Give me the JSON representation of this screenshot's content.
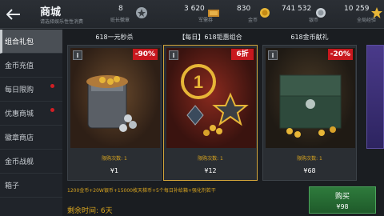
{
  "header": {
    "title": "商城",
    "subtitle": "请选择娱乐性性消费",
    "stats": [
      {
        "value": "8",
        "label": "贬长徽章"
      },
      {
        "value": "3 620",
        "label": "军需券"
      },
      {
        "value": "830",
        "label": "金币"
      },
      {
        "value": "741 532",
        "label": "银币"
      },
      {
        "value": "10 259",
        "label": "全局经验"
      }
    ]
  },
  "sidebar": {
    "items": [
      {
        "label": "组合礼包"
      },
      {
        "label": "金币充值"
      },
      {
        "label": "每日限购"
      },
      {
        "label": "优惠商城"
      },
      {
        "label": "徽章商店"
      },
      {
        "label": "金币战舰"
      },
      {
        "label": "箱子"
      }
    ]
  },
  "cards": [
    {
      "title": "618一元秒杀",
      "badge": "-90%",
      "limit": "限购次数: 1",
      "price": "¥1"
    },
    {
      "title": "【每日】618钜惠组合",
      "badge": "6折",
      "limit": "限购次数: 1",
      "price": "¥12"
    },
    {
      "title": "618金币献礼",
      "badge": "-20%",
      "limit": "限购次数: 1",
      "price": "¥68"
    }
  ],
  "bottom": {
    "description": "1200金币+20W银币+15000枚天梯币+5个每日补给箱+强化剂若干",
    "remaining": "剩余时间: 6天",
    "buy_label": "购买",
    "buy_price": "¥98"
  },
  "colors": {
    "accent_red": "#c8181e",
    "accent_gold": "#d9a520",
    "buy_green": "#2e7b3c"
  }
}
